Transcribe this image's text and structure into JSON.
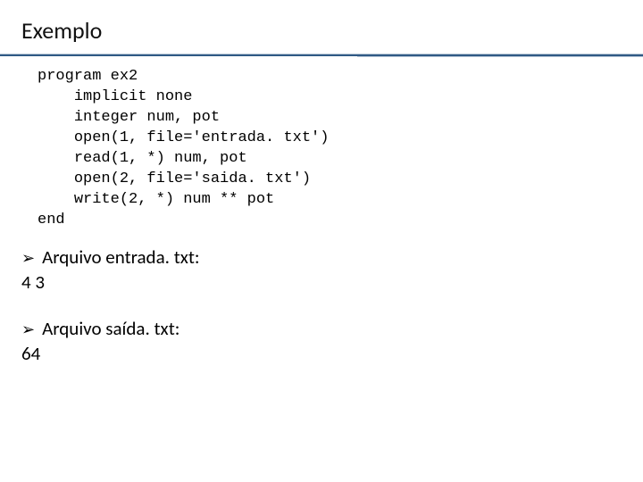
{
  "title": "Exemplo",
  "code": {
    "l0": "program ex2",
    "l1": "implicit none",
    "l2": "integer num, pot",
    "l3": "open(1, file='entrada. txt')",
    "l4": "read(1, *) num, pot",
    "l5": "open(2, file='saida. txt')",
    "l6": "write(2, *) num ** pot",
    "l7": "end"
  },
  "files": {
    "entrada": {
      "label": "Arquivo entrada. txt:",
      "content": "4   3"
    },
    "saida": {
      "label": "Arquivo saída. txt:",
      "content": "64"
    }
  }
}
